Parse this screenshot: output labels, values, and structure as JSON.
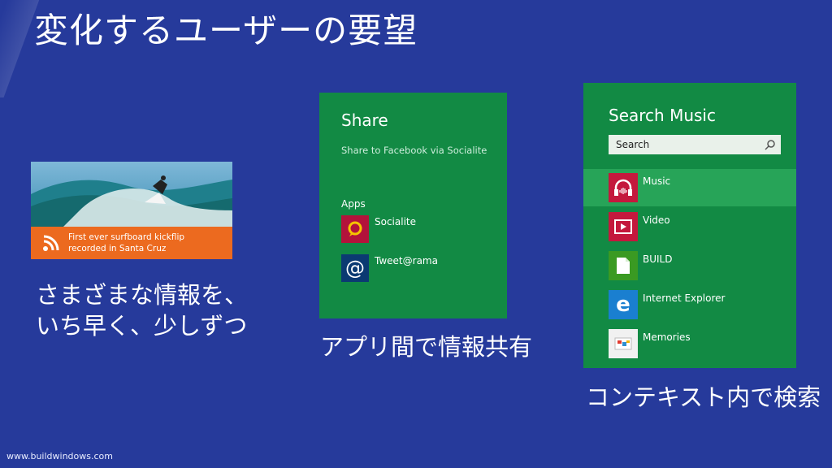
{
  "title": "変化するユーザーの要望",
  "captions": {
    "news": "さまざまな情報を、\nいち早く、少しずつ",
    "share": "アプリ間で情報共有",
    "search": "コンテキスト内で検索"
  },
  "footer": "www.buildwindows.com",
  "news_tile": {
    "headline": "First ever surfboard kickflip\nrecorded in Santa Cruz",
    "icon": "rss-icon",
    "bar_color": "#ec6a1f"
  },
  "share_panel": {
    "title": "Share",
    "subtitle": "Share to Facebook via Socialite",
    "apps_heading": "Apps",
    "apps": [
      {
        "label": "Socialite",
        "icon": "socialite-icon"
      },
      {
        "label": "Tweet@rama",
        "icon": "at-sign-icon"
      }
    ],
    "bg_color": "#128a44"
  },
  "search_panel": {
    "title": "Search Music",
    "search_placeholder": "Search",
    "results": [
      {
        "label": "Music",
        "icon": "headphones-icon",
        "selected": true
      },
      {
        "label": "Video",
        "icon": "video-play-icon"
      },
      {
        "label": "BUILD",
        "icon": "document-icon"
      },
      {
        "label": "Internet Explorer",
        "icon": "internet-explorer-icon"
      },
      {
        "label": "Memories",
        "icon": "memories-icon"
      }
    ]
  }
}
